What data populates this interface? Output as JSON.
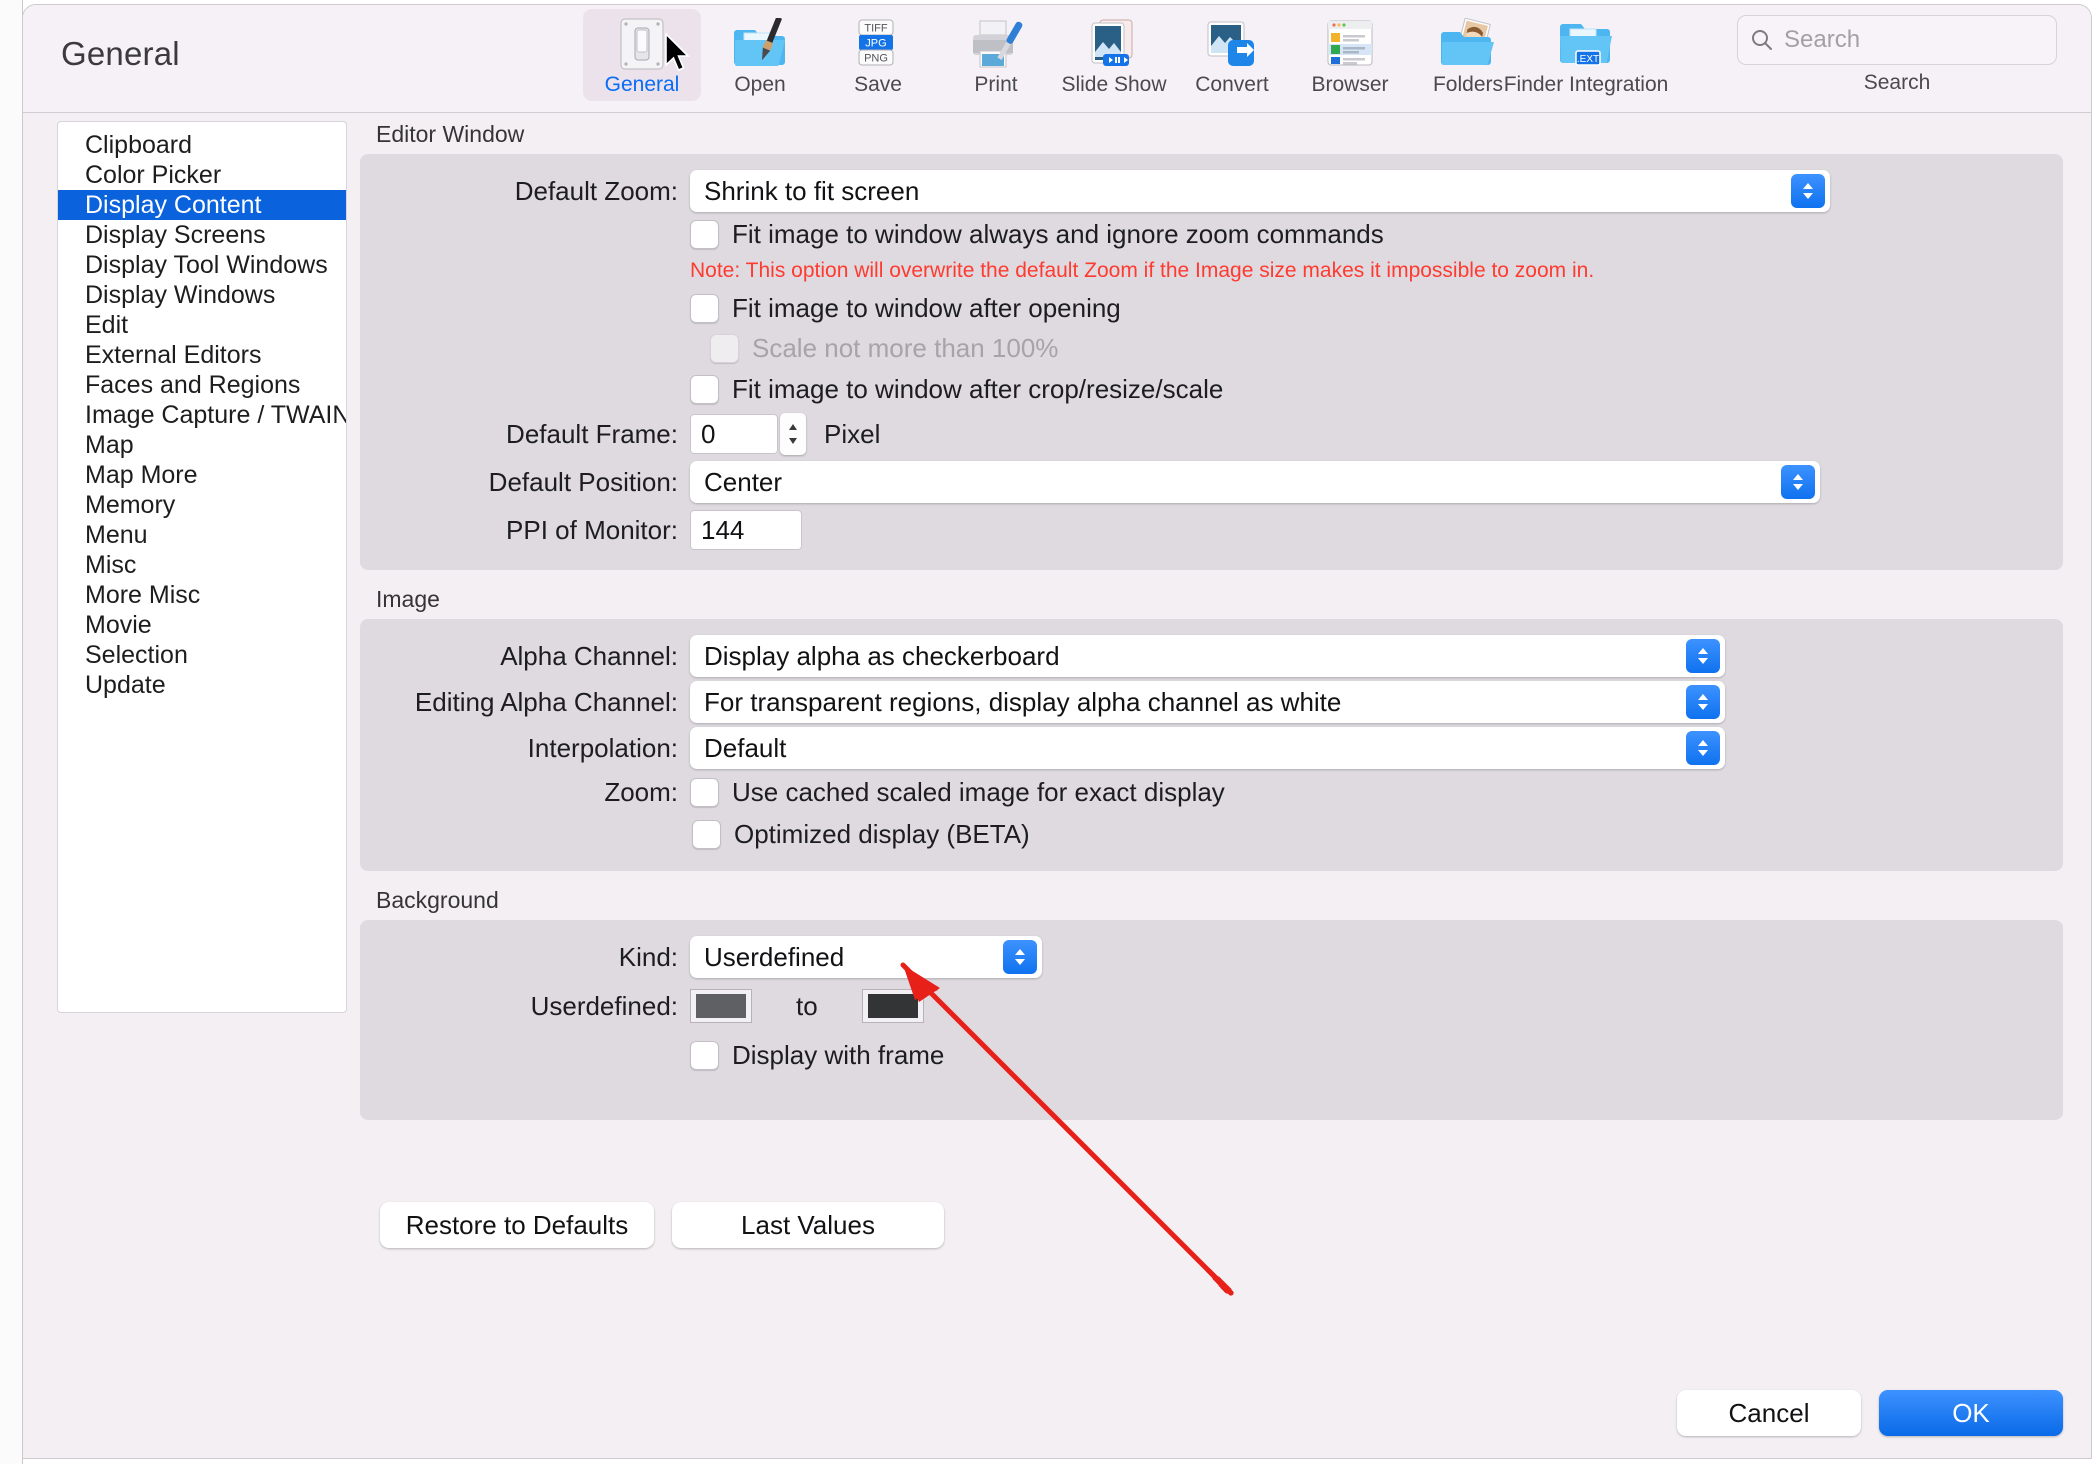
{
  "window": {
    "title": "General"
  },
  "toolbar": {
    "items": [
      {
        "label": "General",
        "icon": "switch-toggle-icon",
        "active": true
      },
      {
        "label": "Open",
        "icon": "folder-brush-icon",
        "active": false
      },
      {
        "label": "Save",
        "icon": "file-formats-icon",
        "active": false
      },
      {
        "label": "Print",
        "icon": "printer-icon",
        "active": false
      },
      {
        "label": "Slide Show",
        "icon": "slideshow-icon",
        "active": false
      },
      {
        "label": "Convert",
        "icon": "convert-arrow-icon",
        "active": false
      },
      {
        "label": "Browser",
        "icon": "browser-list-icon",
        "active": false
      },
      {
        "label": "Folders",
        "icon": "folder-photo-icon",
        "active": false
      },
      {
        "label": "Finder Integration",
        "icon": "folder-ext-icon",
        "active": false
      }
    ],
    "save_icon_labels": [
      "TIFF",
      "JPG",
      "PNG"
    ],
    "finder_badge": ".EXT"
  },
  "search": {
    "placeholder": "Search",
    "caption": "Search",
    "icon": "search-icon"
  },
  "sidebar": {
    "items": [
      {
        "label": "Clipboard",
        "selected": false
      },
      {
        "label": "Color Picker",
        "selected": false
      },
      {
        "label": "Display Content",
        "selected": true
      },
      {
        "label": "Display Screens",
        "selected": false
      },
      {
        "label": "Display Tool Windows",
        "selected": false
      },
      {
        "label": "Display Windows",
        "selected": false
      },
      {
        "label": "Edit",
        "selected": false
      },
      {
        "label": "External Editors",
        "selected": false
      },
      {
        "label": "Faces and Regions",
        "selected": false
      },
      {
        "label": "Image Capture / TWAIN",
        "selected": false
      },
      {
        "label": "Map",
        "selected": false
      },
      {
        "label": "Map More",
        "selected": false
      },
      {
        "label": "Memory",
        "selected": false
      },
      {
        "label": "Menu",
        "selected": false
      },
      {
        "label": "Misc",
        "selected": false
      },
      {
        "label": "More Misc",
        "selected": false
      },
      {
        "label": "Movie",
        "selected": false
      },
      {
        "label": "Selection",
        "selected": false
      },
      {
        "label": "Update",
        "selected": false
      }
    ]
  },
  "editor_window": {
    "group_title": "Editor Window",
    "default_zoom_label": "Default Zoom:",
    "default_zoom_value": "Shrink to fit screen",
    "fit_always_label": "Fit image to window always and ignore zoom commands",
    "fit_always_checked": false,
    "note": "Note: This option will overwrite the default Zoom if the Image size makes it impossible to zoom in.",
    "fit_after_opening_label": "Fit image to window after opening",
    "fit_after_opening_checked": false,
    "scale_not_more_label": "Scale not more than 100%",
    "scale_not_more_checked": false,
    "scale_not_more_disabled": true,
    "fit_after_crop_label": "Fit image to window after crop/resize/scale",
    "fit_after_crop_checked": false,
    "default_frame_label": "Default Frame:",
    "default_frame_value": "0",
    "default_frame_unit": "Pixel",
    "default_position_label": "Default Position:",
    "default_position_value": "Center",
    "ppi_label": "PPI of Monitor:",
    "ppi_value": "144"
  },
  "image": {
    "group_title": "Image",
    "alpha_channel_label": "Alpha Channel:",
    "alpha_channel_value": "Display alpha as checkerboard",
    "editing_alpha_label": "Editing Alpha Channel:",
    "editing_alpha_value": "For transparent regions, display alpha channel as white",
    "interpolation_label": "Interpolation:",
    "interpolation_value": "Default",
    "zoom_label": "Zoom:",
    "use_cached_label": "Use cached scaled image for exact display",
    "use_cached_checked": false,
    "optimized_display_label": "Optimized display (BETA)",
    "optimized_display_checked": false
  },
  "background": {
    "group_title": "Background",
    "kind_label": "Kind:",
    "kind_value": "Userdefined",
    "userdefined_label": "Userdefined:",
    "to_label": "to",
    "color_from": "#5e6063",
    "color_to": "#333436",
    "display_frame_label": "Display with frame",
    "display_frame_checked": false
  },
  "actions": {
    "restore_defaults": "Restore to Defaults",
    "last_values": "Last Values",
    "cancel": "Cancel",
    "ok": "OK"
  },
  "colors": {
    "accent": "#0a62dd",
    "note_red": "#ff3b30",
    "annotation_red": "#e8201a"
  }
}
